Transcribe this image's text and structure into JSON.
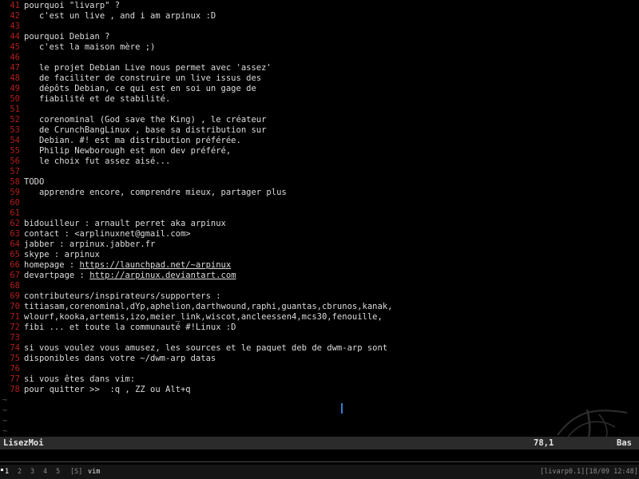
{
  "editor": {
    "lines": [
      {
        "num": "41",
        "text": "pourquoi \"livarp\" ?"
      },
      {
        "num": "42",
        "text": "   c'est un live , and i am arpinux :D"
      },
      {
        "num": "43",
        "text": ""
      },
      {
        "num": "44",
        "text": "pourquoi Debian ?"
      },
      {
        "num": "45",
        "text": "   c'est la maison mère ;)"
      },
      {
        "num": "46",
        "text": ""
      },
      {
        "num": "47",
        "text": "   le projet Debian Live nous permet avec 'assez'"
      },
      {
        "num": "48",
        "text": "   de faciliter de construire un live issus des"
      },
      {
        "num": "49",
        "text": "   dépôts Debian, ce qui est en soi un gage de"
      },
      {
        "num": "50",
        "text": "   fiabilité et de stabilité."
      },
      {
        "num": "51",
        "text": ""
      },
      {
        "num": "52",
        "text": "   corenominal (God save the King) , le créateur"
      },
      {
        "num": "53",
        "text": "   de CrunchBangLinux , base sa distribution sur"
      },
      {
        "num": "54",
        "text": "   Debian. #! est ma distribution préférée."
      },
      {
        "num": "55",
        "text": "   Philip Newborough est mon dev préféré,"
      },
      {
        "num": "56",
        "text": "   le choix fut assez aisé..."
      },
      {
        "num": "57",
        "text": ""
      },
      {
        "num": "58",
        "text": "TODO"
      },
      {
        "num": "59",
        "text": "   apprendre encore, comprendre mieux, partager plus"
      },
      {
        "num": "60",
        "text": ""
      },
      {
        "num": "61",
        "text": ""
      },
      {
        "num": "62",
        "text": "bidouilleur : arnault perret aka arpinux"
      },
      {
        "num": "63",
        "text": "contact : <arplinuxnet@gmail.com>"
      },
      {
        "num": "64",
        "text": "jabber : arpinux.jabber.fr"
      },
      {
        "num": "65",
        "text": "skype : arpinux"
      },
      {
        "num": "66",
        "text": "homepage : ",
        "link": "https://launchpad.net/~arpinux"
      },
      {
        "num": "67",
        "text": "devartpage : ",
        "link": "http://arpinux.deviantart.com"
      },
      {
        "num": "68",
        "text": ""
      },
      {
        "num": "69",
        "text": "contributeurs/inspirateurs/supporters :"
      },
      {
        "num": "70",
        "text": "titiasam,corenominal,dYp,aphelion,darthwound,raphi,guantas,cbrunos,kanak,"
      },
      {
        "num": "71",
        "text": "wlourf,kooka,artemis,izo,meier_link,wiscot,ancleessen4,mcs30,fenouille,"
      },
      {
        "num": "72",
        "text": "fibi ... et toute la communauté #!Linux :D"
      },
      {
        "num": "73",
        "text": ""
      },
      {
        "num": "74",
        "text": "si vous voulez vous amusez, les sources et le paquet deb de dwm-arp sont"
      },
      {
        "num": "75",
        "text": "disponibles dans votre ~/dwm-arp datas"
      },
      {
        "num": "76",
        "text": ""
      },
      {
        "num": "77",
        "text": "si vous êtes dans vim:"
      },
      {
        "num": "78",
        "text": "pour quitter >>  :q , ZZ ou Alt+q"
      }
    ],
    "tildes": [
      "~",
      "~",
      "~",
      "~"
    ]
  },
  "statusbar": {
    "filename": "LisezMoi",
    "position": "78,1",
    "scroll": "Bas"
  },
  "taskbar": {
    "tags": [
      "1",
      "2",
      "3",
      "4",
      "5"
    ],
    "active_tag_index": 0,
    "layout": "[S]",
    "window_title": "vim",
    "sysinfo": "[livarp0.1][18/09 12:48]"
  },
  "colors": {
    "line_number": "#b21e1e",
    "text": "#dcdcdc",
    "background": "#000000",
    "statusbar_bg": "#2b2b2b",
    "cursor": "#3a7bd5"
  },
  "icons": {
    "watermark": "livarp-brush-logo"
  }
}
